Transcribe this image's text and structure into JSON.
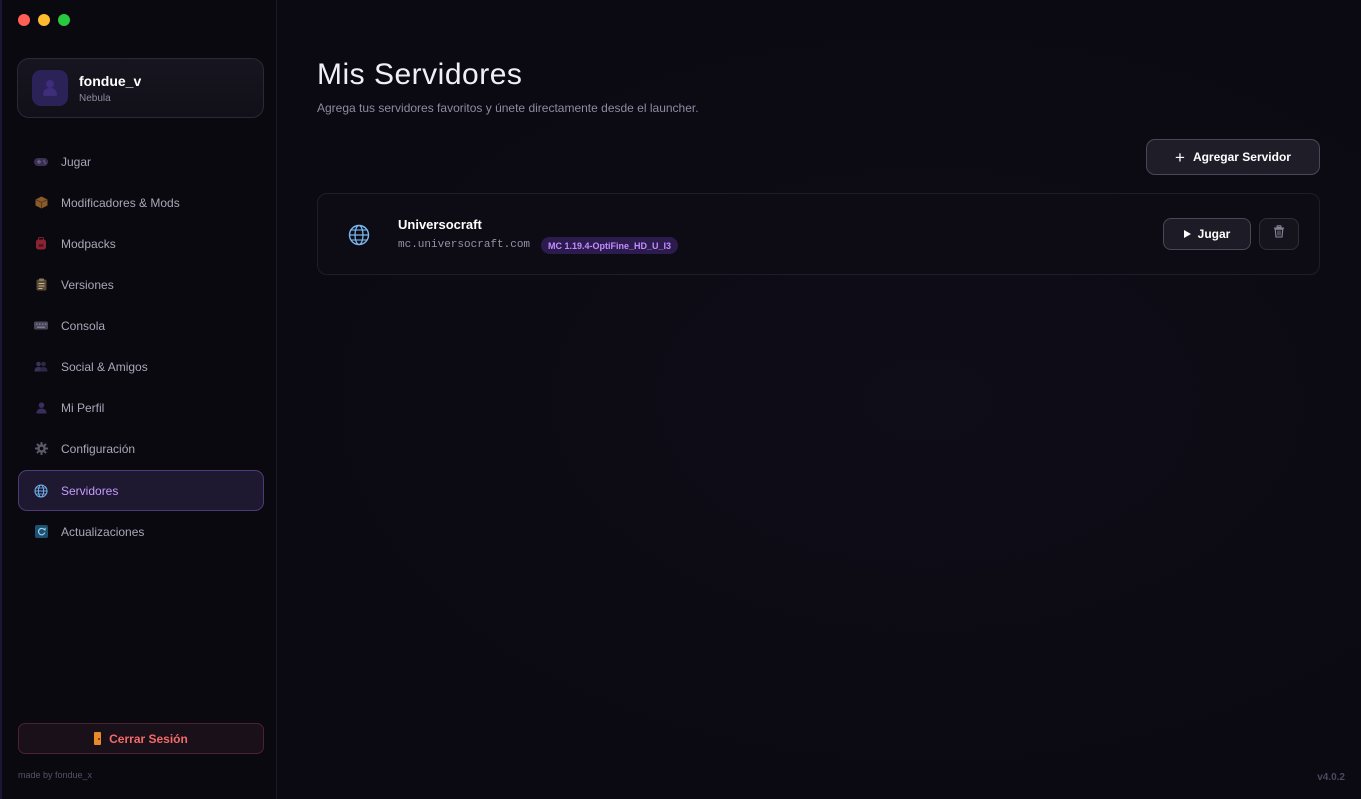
{
  "window": {
    "controls": [
      "close",
      "minimize",
      "maximize"
    ]
  },
  "profile": {
    "username": "fondue_v",
    "subtitle": "Nebula"
  },
  "sidebar": {
    "items": [
      {
        "label": "Jugar",
        "icon": "gamepad-icon",
        "active": false
      },
      {
        "label": "Modificadores & Mods",
        "icon": "package-icon",
        "active": false
      },
      {
        "label": "Modpacks",
        "icon": "backpack-icon",
        "active": false
      },
      {
        "label": "Versiones",
        "icon": "clipboard-icon",
        "active": false
      },
      {
        "label": "Consola",
        "icon": "keyboard-icon",
        "active": false
      },
      {
        "label": "Social & Amigos",
        "icon": "users-icon",
        "active": false
      },
      {
        "label": "Mi Perfil",
        "icon": "user-icon",
        "active": false
      },
      {
        "label": "Configuración",
        "icon": "gear-icon",
        "active": false
      },
      {
        "label": "Servidores",
        "icon": "globe-icon",
        "active": true
      },
      {
        "label": "Actualizaciones",
        "icon": "refresh-icon",
        "active": false
      }
    ],
    "logout_label": "Cerrar Sesión",
    "credit": "made by fondue_x"
  },
  "main": {
    "title": "Mis Servidores",
    "subtitle": "Agrega tus servidores favoritos y únete directamente desde el launcher.",
    "add_button_label": "Agregar Servidor",
    "servers": [
      {
        "name": "Universocraft",
        "address": "mc.universocraft.com",
        "version": "MC 1.19.4-OptiFine_HD_U_I3",
        "play_label": "Jugar"
      }
    ]
  },
  "app_version": "v4.0.2",
  "colors": {
    "accent": "#c38cff",
    "danger": "#f36a6a",
    "background": "#0b0a12"
  }
}
